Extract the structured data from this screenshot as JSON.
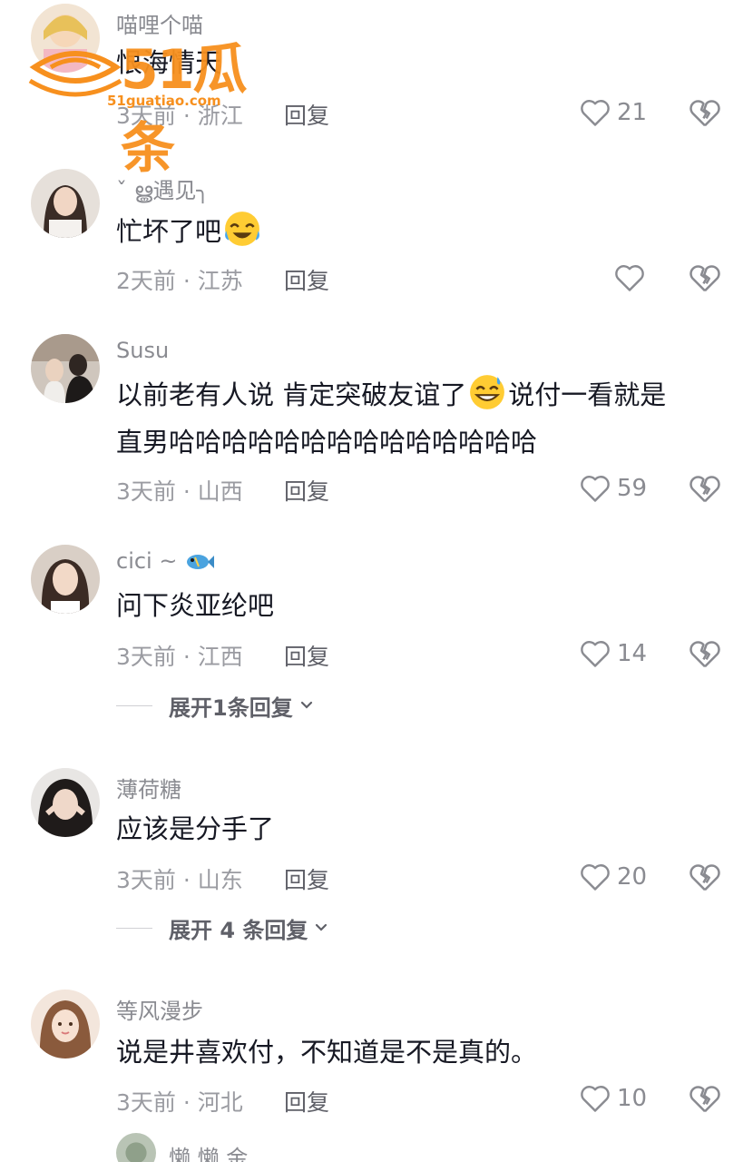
{
  "watermark": {
    "brand": "51瓜条",
    "url": "51guatiao.com"
  },
  "comments": [
    {
      "username": "喵哩个喵",
      "text": "恨海情天",
      "time": "3天前",
      "location": "浙江",
      "reply": "回复",
      "likes": "21",
      "avatar_color": "#e9c9a8"
    },
    {
      "username": "ˇ ൠ遇见╮",
      "text": "忙坏了吧",
      "time": "2天前",
      "location": "江苏",
      "reply": "回复",
      "likes": "",
      "avatar_color": "#c9b9ae"
    },
    {
      "username": "Susu",
      "text_line1": "以前老有人说 肯定突破友谊了",
      "text_line1b": "说付一看就是",
      "text_line2": "直男哈哈哈哈哈哈哈哈哈哈哈哈哈哈",
      "time": "3天前",
      "location": "山西",
      "reply": "回复",
      "likes": "59",
      "avatar_color": "#8c7d6f"
    },
    {
      "username": "cici ~ ",
      "text": "问下炎亚纶吧",
      "time": "3天前",
      "location": "江西",
      "reply": "回复",
      "likes": "14",
      "expand": "展开1条回复",
      "avatar_color": "#c29b84"
    },
    {
      "username": "薄荷糖",
      "text": "应该是分手了",
      "time": "3天前",
      "location": "山东",
      "reply": "回复",
      "likes": "20",
      "expand": "展开 4 条回复",
      "avatar_color": "#6f6a66"
    },
    {
      "username": "等风漫步",
      "text": "说是井喜欢付，不知道是不是真的。",
      "time": "3天前",
      "location": "河北",
      "reply": "回复",
      "likes": "10",
      "avatar_color": "#d9b49a"
    },
    {
      "username": "懒 懒 金"
    }
  ],
  "separator": " · ",
  "colors": {
    "text": "#161823",
    "meta": "#9a9ba1",
    "username": "#8a8b91",
    "watermark": "#f7901e"
  }
}
